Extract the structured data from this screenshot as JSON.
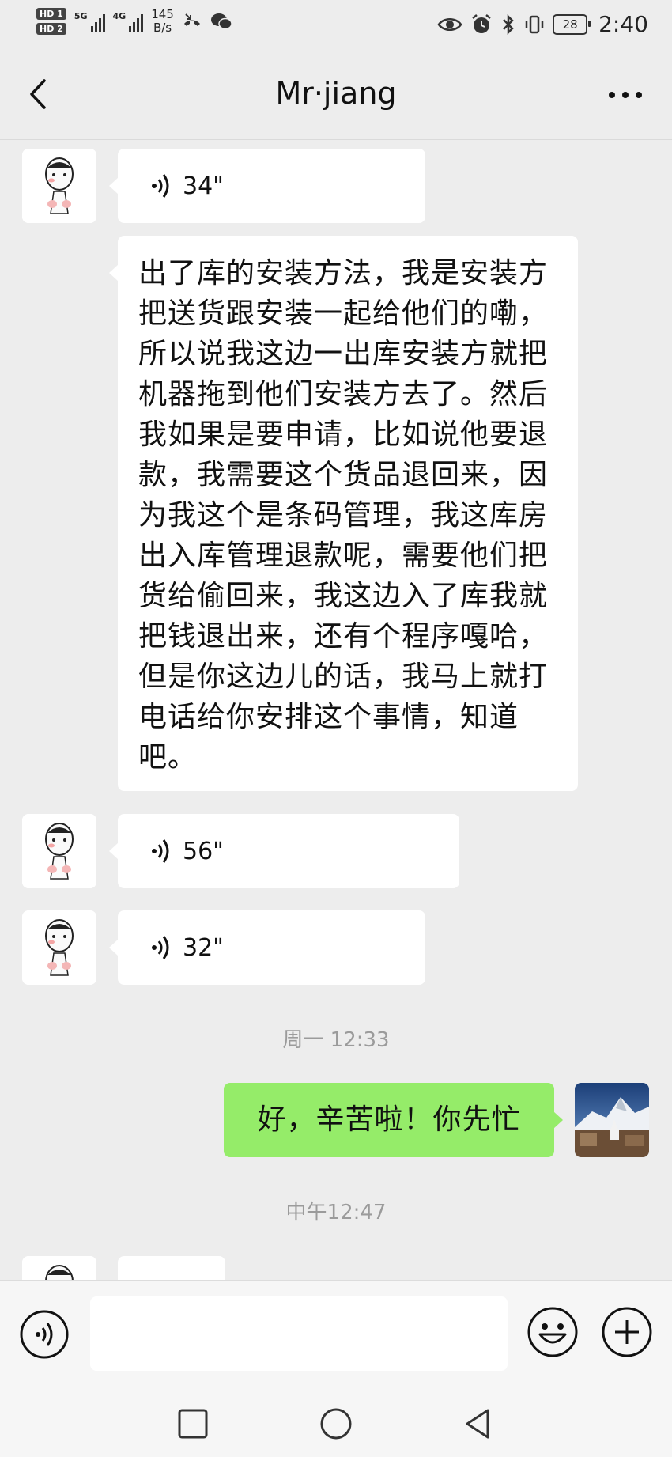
{
  "status_bar": {
    "hd1": "HD 1",
    "hd2": "HD 2",
    "sim1_label": "5G",
    "sim2_label": "4G",
    "speed_value": "145",
    "speed_unit": "B/s",
    "battery": "28",
    "time": "2:40"
  },
  "nav": {
    "title": "Mr·jiang",
    "back_icon": "chevron-left-icon",
    "more_icon": "more-dots-icon"
  },
  "messages": [
    {
      "type": "voice",
      "side": "left",
      "duration": "34\""
    },
    {
      "type": "text",
      "side": "left",
      "text": "出了库的安装方法，我是安装方把送货跟安装一起给他们的嘞，所以说我这边一出库安装方就把机器拖到他们安装方去了。然后我如果是要申请，比如说他要退款，我需要这个货品退回来，因为我这个是条码管理，我这库房出入库管理退款呢，需要他们把货给偷回来，我这边入了库我就把钱退出来，还有个程序嘎哈，但是你这边儿的话，我马上就打电话给你安排这个事情，知道吧。"
    },
    {
      "type": "voice",
      "side": "left",
      "duration": "56\""
    },
    {
      "type": "voice",
      "side": "left",
      "duration": "32\""
    },
    {
      "type": "timestamp",
      "text": "周一 12:33"
    },
    {
      "type": "text",
      "side": "right",
      "text": "好，辛苦啦！你先忙"
    },
    {
      "type": "timestamp",
      "text": "中午12:47"
    }
  ],
  "colors": {
    "background": "#ededed",
    "bubble_in": "#ffffff",
    "bubble_out": "#95ec69",
    "timestamp": "#9b9b9b"
  },
  "input_bar": {
    "voice_icon": "voice-input-icon",
    "emoji_icon": "emoji-icon",
    "plus_icon": "plus-icon",
    "value": ""
  },
  "system_nav": {
    "recent_icon": "square-recents-icon",
    "home_icon": "circle-home-icon",
    "back_icon": "triangle-back-icon"
  }
}
